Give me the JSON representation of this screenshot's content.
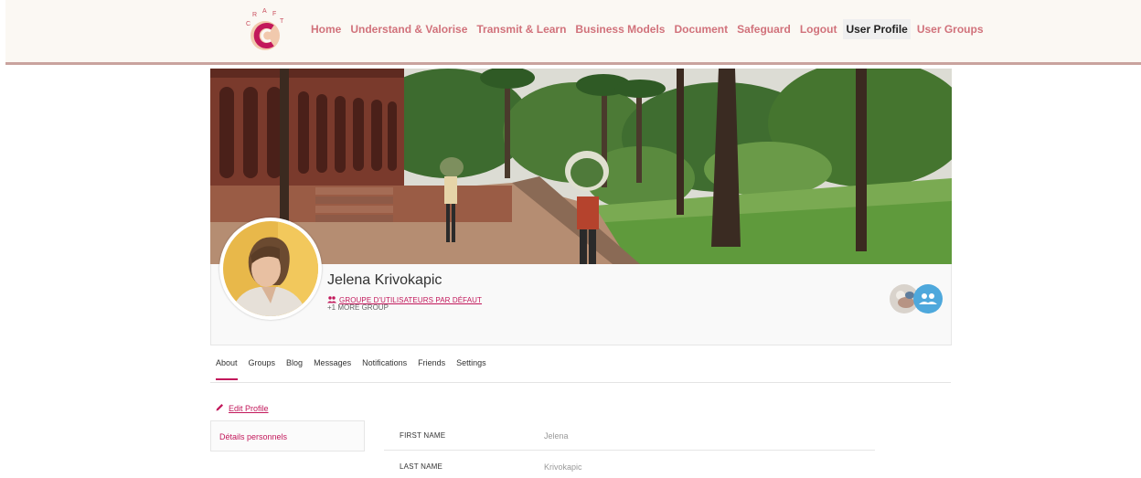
{
  "nav": {
    "logo_letters": [
      "C",
      "R",
      "A",
      "F",
      "T"
    ],
    "items": [
      {
        "label": "Home",
        "active": false
      },
      {
        "label": "Understand & Valorise",
        "active": false
      },
      {
        "label": "Transmit & Learn",
        "active": false
      },
      {
        "label": "Business Models",
        "active": false
      },
      {
        "label": "Document",
        "active": false
      },
      {
        "label": "Safeguard",
        "active": false
      },
      {
        "label": "Logout",
        "active": false
      },
      {
        "label": "User Profile",
        "active": true
      },
      {
        "label": "User Groups",
        "active": false
      }
    ]
  },
  "profile": {
    "name": "Jelena Krivokapic",
    "group_link": "GROUPE D'UTILISATEURS PAR DÉFAUT",
    "more_groups": "+1 MORE GROUP"
  },
  "tabs": [
    "About",
    "Groups",
    "Blog",
    "Messages",
    "Notifications",
    "Friends",
    "Settings"
  ],
  "about": {
    "edit_label": "Edit Profile",
    "section_label": "Détails personnels",
    "fields": [
      {
        "label": "FIRST NAME",
        "value": "Jelena"
      },
      {
        "label": "LAST NAME",
        "value": "Krivokapic"
      }
    ]
  },
  "colors": {
    "accent": "#c2185b",
    "nav_link": "#d1727b",
    "topbar_bg": "#fbf8f3",
    "topbar_border": "#c9a39e",
    "group_badge": "#4ea8dc"
  }
}
